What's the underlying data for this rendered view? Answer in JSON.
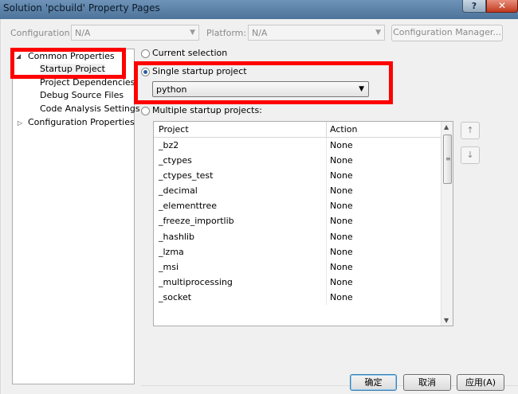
{
  "window": {
    "title": "Solution 'pcbuild' Property Pages",
    "help_label": "?",
    "close_label": "✕"
  },
  "toolbar": {
    "configuration_label": "Configuration:",
    "configuration_value": "N/A",
    "platform_label": "Platform:",
    "platform_value": "N/A",
    "config_manager_label": "Configuration Manager...",
    "dropdown_glyph": "▼"
  },
  "tree": {
    "expanded_glyph": "◢",
    "collapsed_glyph": "▷",
    "common_properties": "Common Properties",
    "items": [
      "Startup Project",
      "Project Dependencies",
      "Debug Source Files",
      "Code Analysis Settings"
    ],
    "configuration_properties": "Configuration Properties"
  },
  "startup": {
    "current_selection_label": "Current selection",
    "single_label": "Single startup project",
    "single_value": "python",
    "multiple_label": "Multiple startup projects:",
    "selected_option": "single"
  },
  "grid": {
    "columns": [
      "Project",
      "Action"
    ],
    "rows": [
      {
        "project": "_bz2",
        "action": "None"
      },
      {
        "project": "_ctypes",
        "action": "None"
      },
      {
        "project": "_ctypes_test",
        "action": "None"
      },
      {
        "project": "_decimal",
        "action": "None"
      },
      {
        "project": "_elementtree",
        "action": "None"
      },
      {
        "project": "_freeze_importlib",
        "action": "None"
      },
      {
        "project": "_hashlib",
        "action": "None"
      },
      {
        "project": "_lzma",
        "action": "None"
      },
      {
        "project": "_msi",
        "action": "None"
      },
      {
        "project": "_multiprocessing",
        "action": "None"
      },
      {
        "project": "_socket",
        "action": "None"
      }
    ],
    "scroll_up": "▲",
    "scroll_down": "▼",
    "grip": "≡"
  },
  "move": {
    "up_label": "↑",
    "down_label": "↓"
  },
  "buttons": {
    "ok": "确定",
    "cancel": "取消",
    "apply": "应用(A)"
  },
  "colors": {
    "highlight": "#ff0000",
    "titlebar": "#5a80a8",
    "close": "#c23a1f",
    "default_button_border": "#3c7fb1"
  }
}
